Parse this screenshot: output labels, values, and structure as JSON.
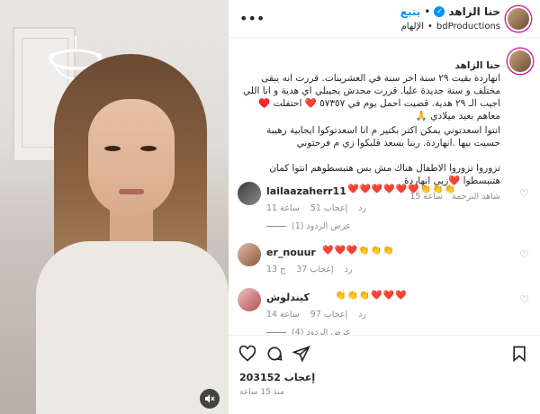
{
  "header": {
    "author": "حنا الزاهد",
    "follow_label": "يتبع",
    "dot": "•",
    "collaborator": "bdProductions",
    "subtitle": "الإلهام",
    "more_icon": "more-horizontal-icon"
  },
  "caption": {
    "author": "حنا الزاهد",
    "text_1": "انهاردة بقيت ٢٩ سنة اخر سنة في العشرينات. قررت انه يبقى مختلف و سنة جديدة عليا. قررت محدش يجيبلي اي هدية و انا اللي اجيب الـ ٢٩ هدية. قضيت احمل يوم في ٥٧٣٥٧ ❤️ احتفلت ♥️ معاهم بعيد ميلادي 🙏",
    "text_2": "انتوا اسعدتوني يمكن اكتر بكتير م انا اسعدتوكوا ايجابية رهيبة حسيت بيها .انهاردة. ربنا يسعد قلبكوا زي م فرحتوني",
    "text_3": "تزوروا تزوروا الاطفال هناك مش بس هتبسطوهم انتوا كمان هتنبسطوا ❤️زيي انهاردة",
    "see_translation": "شاهد الترجمة",
    "time": "ساعة 15"
  },
  "comments": [
    {
      "user": "lailaazaherr11",
      "emojis": "❤️❤️❤️❤️❤️❤️👏👏👏",
      "likes": "إعجاب 51",
      "reply": "رد",
      "time": "ساعة 11",
      "view_replies": "عرض الردود (1)"
    },
    {
      "user": "er_nouur",
      "emojis": "❤️❤️❤️👏👏👏",
      "likes": "إعجاب 37",
      "reply": "رد",
      "time": "ج 13",
      "view_replies": ""
    },
    {
      "user": "كيندلوش",
      "emojis": "👏👏👏❤️❤️❤️",
      "likes": "إعجاب 97",
      "reply": "رد",
      "time": "ساعة 14",
      "view_replies": "عرض الردود (4)"
    }
  ],
  "actions": {
    "likes": "203152 إعجاب",
    "posted": "منذ 15 ساعة",
    "icons": [
      "heart-icon",
      "comment-icon",
      "share-icon",
      "bookmark-icon"
    ]
  },
  "media": {
    "mute_icon": "volume-muted-icon"
  },
  "colors": {
    "accent": "#0095f6",
    "heart": "#ed4956",
    "muted": "#8e8e8e"
  }
}
